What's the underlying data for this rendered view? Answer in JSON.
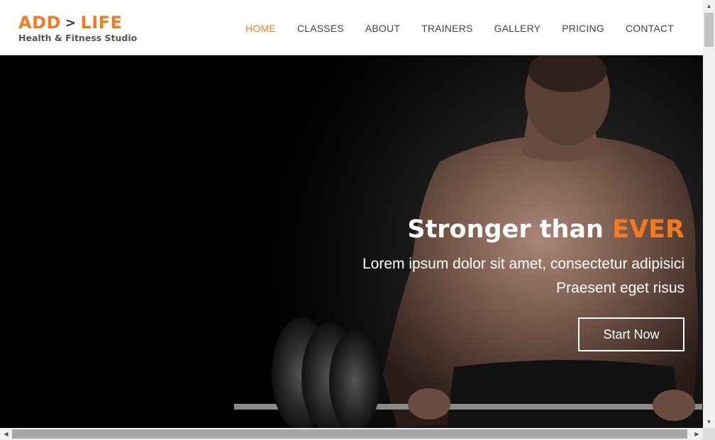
{
  "brand": {
    "name_part1": "ADD",
    "arrow": ">",
    "name_part2": "LIFE",
    "tagline": "Health & Fitness Studio"
  },
  "nav": {
    "items": [
      {
        "label": "HOME",
        "active": true
      },
      {
        "label": "CLASSES"
      },
      {
        "label": "ABOUT"
      },
      {
        "label": "TRAINERS"
      },
      {
        "label": "GALLERY"
      },
      {
        "label": "PRICING"
      },
      {
        "label": "CONTACT"
      }
    ]
  },
  "hero": {
    "headline_part1": "Stronger than",
    "headline_accent": "EVER",
    "line1": "Lorem ipsum dolor sit amet, consectetur adipisici",
    "line2": "Praesent eget risus",
    "cta_label": "Start Now"
  },
  "colors": {
    "accent": "#f47a21",
    "text_dark": "#444444"
  },
  "icons": {
    "scroll_up": "triangle-up-icon",
    "scroll_down": "triangle-down-icon",
    "scroll_left": "triangle-left-icon",
    "scroll_right": "triangle-right-icon"
  }
}
